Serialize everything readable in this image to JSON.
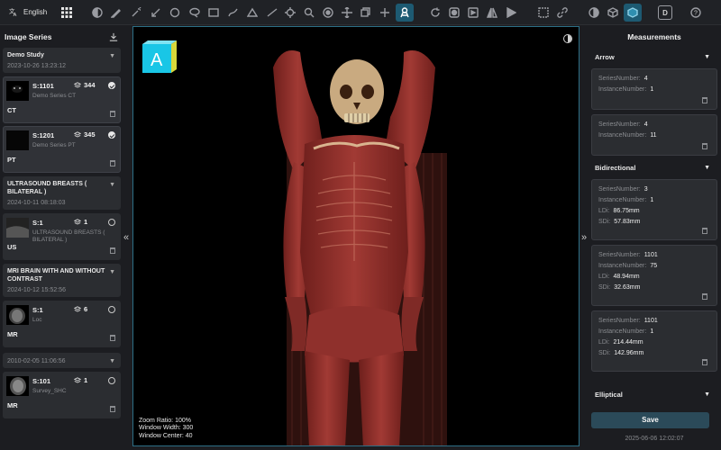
{
  "toolbar": {
    "language": "English",
    "tools": [
      "grid-layout-icon",
      "contrast-icon",
      "pencil-icon",
      "magic-wand-icon",
      "arrow-icon",
      "ellipse-icon",
      "speech-bubble-icon",
      "rectangle-select-icon",
      "freehand-icon",
      "angle-icon",
      "crosshair-icon",
      "zoom-icon",
      "window-level-icon",
      "pan-icon",
      "stack-icon",
      "plus-icon",
      "3d-skeleton-icon",
      "reset-icon",
      "invert-icon",
      "flip-icon",
      "flip-vertical-icon",
      "rotate-icon",
      "split-view-icon",
      "link-icon",
      "mpr-icon",
      "cube-icon",
      "volume-icon",
      "dicom-tag-icon",
      "help-icon"
    ],
    "dicom_label": "D",
    "help_label": "?"
  },
  "left_panel": {
    "title": "Image Series",
    "studies": [
      {
        "name": "Demo Study",
        "date": "2023-10-26 13:23:12",
        "series": [
          {
            "number": "S:1101",
            "count": "344",
            "desc": "Demo Series CT",
            "modality": "CT",
            "selected": true
          },
          {
            "number": "S:1201",
            "count": "345",
            "desc": "Demo Series PT",
            "modality": "PT",
            "selected": true
          }
        ]
      },
      {
        "name": "ULTRASOUND BREASTS ( BILATERAL )",
        "date": "2024-10-11 08:18:03",
        "series": [
          {
            "number": "S:1",
            "count": "1",
            "desc": "ULTRASOUND BREASTS ( BILATERAL )",
            "modality": "US",
            "selected": false
          }
        ]
      },
      {
        "name": "MRI BRAIN WITH AND WITHOUT CONTRAST",
        "date": "2024-10-12 15:52:56",
        "series": [
          {
            "number": "S:1",
            "count": "6",
            "desc": "Loc",
            "modality": "MR",
            "selected": false
          }
        ]
      },
      {
        "name": "",
        "date": "2010-02-05 11:06:56",
        "series": [
          {
            "number": "S:101",
            "count": "1",
            "desc": "Survey_SHC",
            "modality": "MR",
            "selected": false
          }
        ]
      }
    ]
  },
  "viewport": {
    "orientation_label": "A",
    "zoom_ratio": "Zoom Ratio: 100%",
    "window_width": "Window Width: 300",
    "window_center": "Window Center: 40"
  },
  "right_panel": {
    "title": "Measurements",
    "groups": [
      {
        "name": "Arrow",
        "items": [
          {
            "fields": [
              {
                "label": "SeriesNumber:",
                "value": "4"
              },
              {
                "label": "InstanceNumber:",
                "value": "1"
              }
            ]
          },
          {
            "fields": [
              {
                "label": "SeriesNumber:",
                "value": "4"
              },
              {
                "label": "InstanceNumber:",
                "value": "11"
              }
            ]
          }
        ]
      },
      {
        "name": "Bidirectional",
        "items": [
          {
            "fields": [
              {
                "label": "SeriesNumber:",
                "value": "3"
              },
              {
                "label": "InstanceNumber:",
                "value": "1"
              },
              {
                "label": "LDi:",
                "value": "86.75mm"
              },
              {
                "label": "SDi:",
                "value": "57.83mm"
              }
            ]
          },
          {
            "fields": [
              {
                "label": "SeriesNumber:",
                "value": "1101"
              },
              {
                "label": "InstanceNumber:",
                "value": "75"
              },
              {
                "label": "LDi:",
                "value": "48.94mm"
              },
              {
                "label": "SDi:",
                "value": "32.63mm"
              }
            ]
          },
          {
            "fields": [
              {
                "label": "SeriesNumber:",
                "value": "1101"
              },
              {
                "label": "InstanceNumber:",
                "value": "1"
              },
              {
                "label": "LDi:",
                "value": "214.44mm"
              },
              {
                "label": "SDi:",
                "value": "142.96mm"
              }
            ]
          }
        ]
      },
      {
        "name": "Elliptical",
        "items": []
      }
    ],
    "save_label": "Save",
    "footer_date": "2025-06-06 12:02:07"
  },
  "colors": {
    "accent": "#1d5a72",
    "viewport_border": "#2d6f86",
    "save_button": "#2b4a59",
    "cube": "#19c6e6"
  }
}
